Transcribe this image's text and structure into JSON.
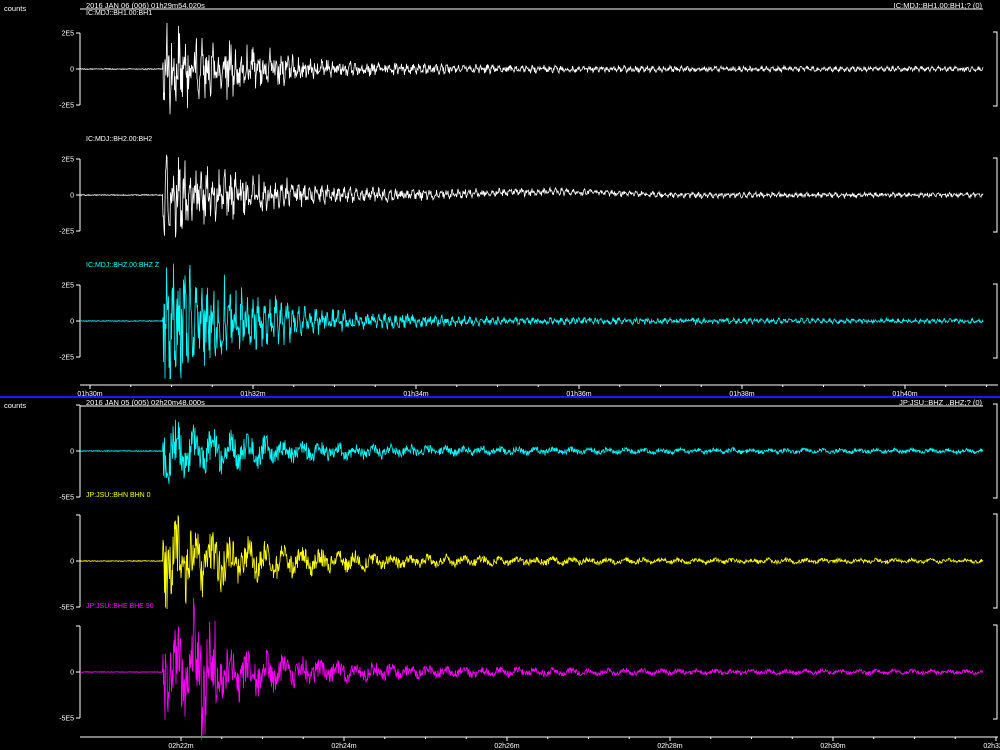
{
  "panels": [
    {
      "units_label": "counts",
      "header_time": "2016 JAN 06 (006) 01h29m54.020s",
      "header_right": "IC:MDJ::BH1.00:BH1;? (0)",
      "x_ticks": [
        "01h30m",
        "01h32m",
        "01h34m",
        "01h36m",
        "01h38m",
        "01h40m"
      ],
      "traces": [
        {
          "label": "IC:MDJ::BH1.00:BH1",
          "color": "#ffffff",
          "y_ticks": [
            "2E5",
            "0",
            "-2E5"
          ],
          "onset_frac": 0.1,
          "amp": 32,
          "drift": false
        },
        {
          "label": "IC:MDJ::BH2.00:BH2",
          "color": "#ffffff",
          "y_ticks": [
            "2E5",
            "0",
            "-2E5"
          ],
          "onset_frac": 0.1,
          "amp": 30,
          "drift": true
        },
        {
          "label": "IC:MDJ::BHZ.00:BHZ Z",
          "color": "#00ffff",
          "y_ticks": [
            "2E5",
            "0",
            "-2E5"
          ],
          "onset_frac": 0.1,
          "amp": 52,
          "drift": false
        }
      ]
    },
    {
      "units_label": "counts",
      "header_time": "2016 JAN 05 (005) 02h20m48.000s",
      "header_right": "JP:JSU::BHZ ..BHZ;? (0)",
      "x_ticks": [
        "02h22m",
        "02h24m",
        "02h26m",
        "02h28m",
        "02h30m",
        "02h32m"
      ],
      "traces": [
        {
          "label": "JP:JSU::BHZ    BHZ Z",
          "color": "#00ffff",
          "y_ticks": [
            "",
            "0",
            "-5E5"
          ],
          "onset_frac": 0.1,
          "amp": 22,
          "drift": false
        },
        {
          "label": "JP:JSU::BHN    BHN 0",
          "color": "#ffff00",
          "y_ticks": [
            "",
            "0",
            "-5E5"
          ],
          "onset_frac": 0.1,
          "amp": 34,
          "drift": false
        },
        {
          "label": "JP:JSU::BHE    BHE 90",
          "color": "#ff00ff",
          "y_ticks": [
            "",
            "0",
            "-5E5"
          ],
          "onset_frac": 0.1,
          "amp": 38,
          "drift": false
        }
      ]
    }
  ]
}
